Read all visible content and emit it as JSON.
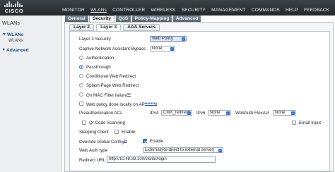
{
  "brand": {
    "logo_text": "CISCO"
  },
  "topnav": [
    "MONITOR",
    "WLANs",
    "CONTROLLER",
    "WIRELESS",
    "SECURITY",
    "MANAGEMENT",
    "COMMANDS",
    "HELP",
    "FEEDBACK"
  ],
  "topnav_active": "WLANs",
  "sidebar": {
    "title": "WLANs",
    "section": "WLANs",
    "section_sub": "WLANs",
    "advanced": "Advanced"
  },
  "tabs": [
    "General",
    "Security",
    "QoS",
    "Policy-Mapping",
    "Advanced"
  ],
  "tabs_active": "Security",
  "subtabs": [
    "Layer 2",
    "Layer 3",
    "AAA Servers"
  ],
  "subtabs_active": "Layer 3",
  "form": {
    "layer3_security_label": "Layer 3 Security",
    "layer3_security_value": "Web Policy",
    "captive_bypass_label": "Captive Network Assistant Bypass",
    "captive_bypass_value": "None",
    "options": {
      "authentication": "Authentication",
      "passthrough": "Passthrough",
      "conditional_redirect": "Conditional Web Redirect",
      "splash_redirect": "Splash Page Web Redirect",
      "mac_filter_failure": "On MAC Filter failure",
      "mac_filter_sup": "10"
    },
    "web_policy_local_ap": "Web policy done locally on AP",
    "web_policy_sup": "warning",
    "preauth_acl_label": "Preauthentication ACL",
    "ipv4_label": "IPv4",
    "ipv4_value": "CMX_redirect",
    "ipv6_label": "IPv6",
    "ipv6_value": "None",
    "flexacl_label": "WebAuth FlexAcl",
    "flexacl_value": "None",
    "qr_label": "Qr Code Scanning",
    "email_label": "Email Input",
    "sleeping_label": "Sleeping Client",
    "sleeping_enable": "Enable",
    "override_label": "Override Global Config",
    "override_sup": "20",
    "override_enable": "Enable",
    "webauth_type_label": "Web Auth type",
    "webauth_type_value": "External(Re-direct to external server)",
    "redirect_label": "Redirect URL",
    "redirect_value": "http://10.48.39.100/visitor/login"
  },
  "colors": {
    "accent": "#2f6fd6",
    "topbar": "#2f3438",
    "tab": "#5d6a73"
  }
}
